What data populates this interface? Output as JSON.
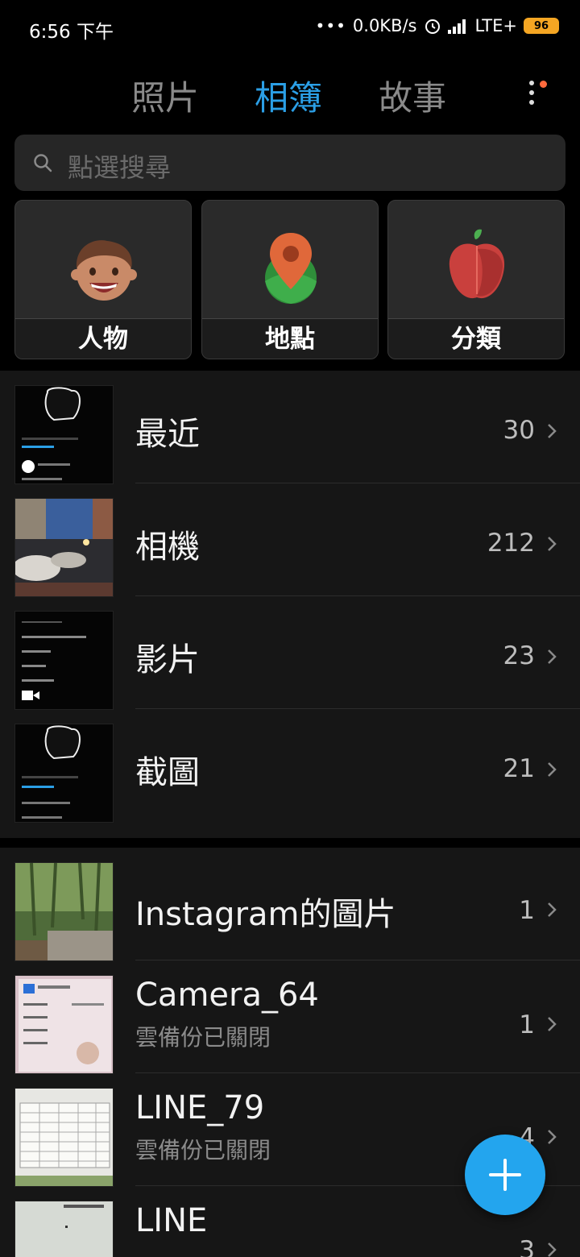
{
  "status_bar": {
    "time": "6:56 下午",
    "net_speed": "0.0KB/s",
    "network": "LTE+",
    "battery": "96"
  },
  "tabs": [
    {
      "label": "照片"
    },
    {
      "label": "相簿",
      "active": true
    },
    {
      "label": "故事"
    }
  ],
  "search": {
    "placeholder": "點選搜尋"
  },
  "categories": [
    {
      "label": "人物",
      "icon": "person-face-icon"
    },
    {
      "label": "地點",
      "icon": "location-pin-icon"
    },
    {
      "label": "分類",
      "icon": "apple-icon"
    }
  ],
  "albums_main": [
    {
      "title": "最近",
      "count": "30"
    },
    {
      "title": "相機",
      "count": "212"
    },
    {
      "title": "影片",
      "count": "23"
    },
    {
      "title": "截圖",
      "count": "21"
    }
  ],
  "albums_other": [
    {
      "title": "Instagram的圖片",
      "subtitle": "",
      "count": "1"
    },
    {
      "title": "Camera_64",
      "subtitle": "雲備份已關閉",
      "count": "1"
    },
    {
      "title": "LINE_79",
      "subtitle": "雲備份已關閉",
      "count": "4"
    },
    {
      "title": "LINE",
      "subtitle": "",
      "count": "3"
    }
  ],
  "colors": {
    "accent": "#2b9fe6",
    "fab": "#23a5ee",
    "battery": "#f5a623"
  }
}
